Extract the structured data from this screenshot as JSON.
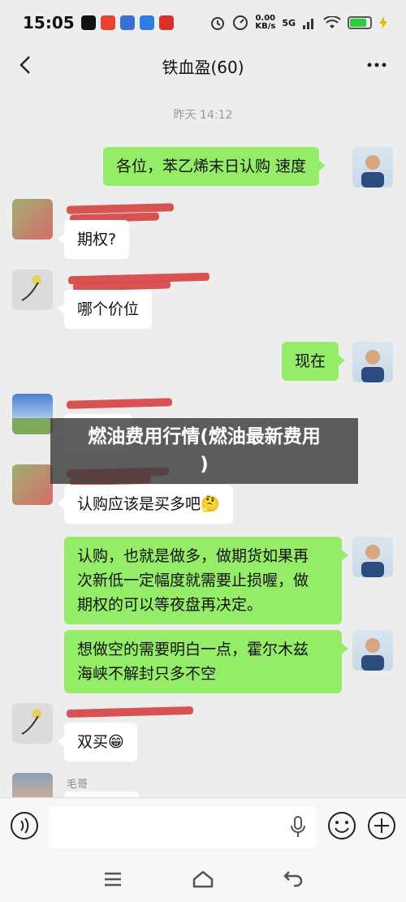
{
  "status_bar": {
    "time": "15:05",
    "net_speed_value": "0.00",
    "net_speed_unit": "KB/s",
    "signal_label": "5G",
    "battery_level": 0.85
  },
  "header": {
    "title": "铁血盈(60)"
  },
  "chat": {
    "timestamp": "昨天 14:12",
    "messages": [
      {
        "text": "各位，苯乙烯末日认购 速度"
      },
      {
        "text": "期权?"
      },
      {
        "text": "哪个价位"
      },
      {
        "text": "现在"
      },
      {
        "text": "认购应该是买多吧🤔"
      },
      {
        "line1": "认购，也就是做多，做期货如果再",
        "line2": "次新低一定幅度就需要止损喔，做",
        "line3": "期权的可以等夜盘再决定。"
      },
      {
        "line1": "想做空的需要明白一点，霍尔木兹",
        "line2": "海峡不解封只多不空"
      },
      {
        "text": "双买😁"
      }
    ],
    "last_sender": "毛哥"
  },
  "overlay": {
    "line1": "燃油费用行情(燃油最新费用",
    "line2": ")"
  },
  "input_bar": {
    "value": ""
  },
  "colors": {
    "chat_bg": "#ededed",
    "own_bubble": "#95ec69",
    "other_bubble": "#ffffff",
    "redaction": "#d84a4a"
  }
}
